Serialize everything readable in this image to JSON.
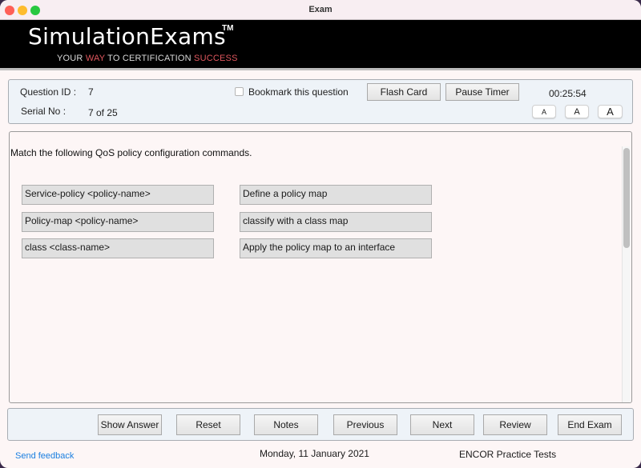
{
  "window": {
    "title": "Exam"
  },
  "banner": {
    "brand": "SimulationExams",
    "trademark": "TM",
    "tagline_parts": [
      {
        "text": "YOUR ",
        "color": "#d9d9d9"
      },
      {
        "text": "WAY",
        "color": "#e0575e"
      },
      {
        "text": " TO CERTIFICATION ",
        "color": "#d9d9d9"
      },
      {
        "text": "SUCCESS",
        "color": "#e0575e"
      }
    ]
  },
  "info": {
    "question_id_label": "Question ID :",
    "question_id_value": "7",
    "serial_label": "Serial No :",
    "serial_value": "7 of 25",
    "bookmark_label": "Bookmark this question",
    "bookmark_checked": false,
    "flash_card_label": "Flash Card",
    "pause_timer_label": "Pause Timer",
    "timer": "00:25:54",
    "font_buttons": [
      "A",
      "A",
      "A"
    ]
  },
  "question": {
    "text": "Match the following QoS policy configuration commands.",
    "left_items": [
      "Service-policy <policy-name>",
      "Policy-map <policy-name>",
      "class <class-name>"
    ],
    "right_items": [
      "Define a policy map",
      "classify with a class map",
      "Apply the policy map to an interface"
    ]
  },
  "nav": {
    "buttons": [
      "Show Answer",
      "Reset",
      "Notes",
      "Previous",
      "Next",
      "Review",
      "End Exam"
    ]
  },
  "footer": {
    "feedback_link": "Send feedback",
    "date": "Monday, 11 January 2021",
    "product": "ENCOR Practice Tests"
  }
}
